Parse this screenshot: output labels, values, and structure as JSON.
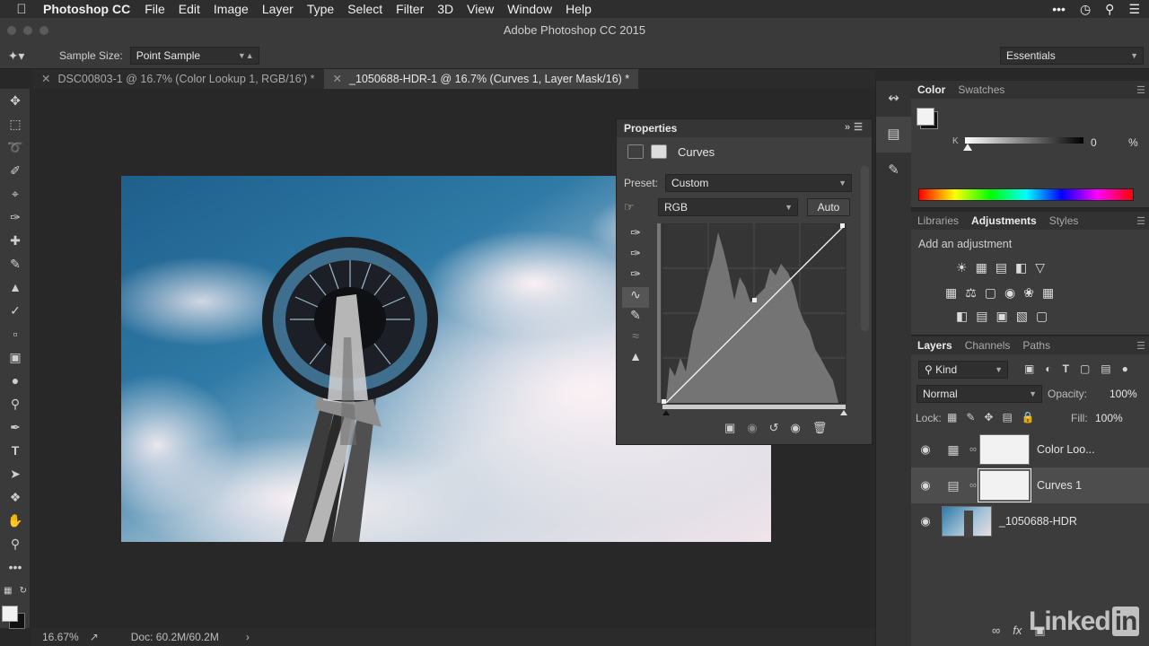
{
  "menubar": {
    "app": "Photoshop CC",
    "items": [
      "File",
      "Edit",
      "Image",
      "Layer",
      "Type",
      "Select",
      "Filter",
      "3D",
      "View",
      "Window",
      "Help"
    ]
  },
  "window": {
    "title": "Adobe Photoshop CC 2015"
  },
  "options": {
    "sample_size_label": "Sample Size:",
    "sample_size_value": "Point Sample",
    "workspace": "Essentials"
  },
  "tabs": [
    {
      "label": "DSC00803-1 @ 16.7% (Color Lookup 1, RGB/16') *",
      "active": false
    },
    {
      "label": "_1050688-HDR-1 @ 16.7% (Curves 1, Layer Mask/16) *",
      "active": true
    }
  ],
  "status": {
    "zoom": "16.67%",
    "doc": "Doc: 60.2M/60.2M"
  },
  "properties": {
    "title": "Properties",
    "type": "Curves",
    "preset_label": "Preset:",
    "preset_value": "Custom",
    "channel": "RGB",
    "auto_label": "Auto"
  },
  "color_panel": {
    "tabs": [
      "Color",
      "Swatches"
    ],
    "slider_label": "K",
    "value": "0",
    "unit": "%"
  },
  "adjustments_panel": {
    "tabs": [
      "Libraries",
      "Adjustments",
      "Styles"
    ],
    "heading": "Add an adjustment"
  },
  "layers_panel": {
    "tabs": [
      "Layers",
      "Channels",
      "Paths"
    ],
    "filter": "Kind",
    "blend_mode": "Normal",
    "opacity_label": "Opacity:",
    "opacity_value": "100%",
    "lock_label": "Lock:",
    "fill_label": "Fill:",
    "fill_value": "100%",
    "layers": [
      {
        "name": "Color Loo...",
        "selected": false
      },
      {
        "name": "Curves 1",
        "selected": true
      },
      {
        "name": "_1050688-HDR",
        "selected": false
      }
    ]
  },
  "watermark": {
    "text": "Linked",
    "in": "in"
  },
  "colors": {
    "accent_blue": "#2a6f9e",
    "panel_bg": "#3c3c3c"
  }
}
